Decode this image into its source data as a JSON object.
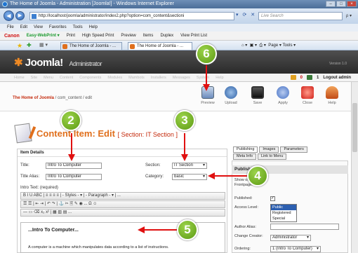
{
  "browser": {
    "window_title": "The Home of Joomla - Administration [Joomla!] - Windows Internet Explorer",
    "address": "http://localhost/joomla/administrator/index2.php?option=com_content&sectioni",
    "search_placeholder": "Live Search",
    "menu": [
      "File",
      "Edit",
      "View",
      "Favorites",
      "Tools",
      "Help"
    ],
    "canon_brand": "Canon",
    "canon_product": "Easy-WebPrint ▾",
    "canon_items": [
      "Print",
      "High Speed Print",
      "Preview",
      "Items",
      "Duplex",
      "View Print List"
    ],
    "tabs": [
      "The Home of Joomla - ...",
      "The Home of Joomla - ..."
    ],
    "tools_text": "Page ▾  Tools ▾"
  },
  "joomla": {
    "logo": "Joomla!",
    "logo_suffix": "Administrator",
    "version": "Version 1.0",
    "nav": [
      "Home",
      "Site",
      "Menu",
      "Content",
      "Components",
      "Modules",
      "Mambots",
      "Installers",
      "Messages",
      "System",
      "Help"
    ],
    "logout": "Logout admin",
    "status_count_a": "0",
    "status_count_b": "1",
    "breadcrumb_home": "The Home of Joomla",
    "breadcrumb_path": " / com_content / edit",
    "toolbar": {
      "preview": "Preview",
      "upload": "Upload",
      "save": "Save",
      "apply": "Apply",
      "close": "Close",
      "help": "Help"
    },
    "content_title": "Content Item: Edit",
    "content_section": "[ Section: IT Section ]",
    "item_details": "Item Details",
    "form": {
      "title_label": "Title:",
      "title_value": "Intro To Computer",
      "alias_label": "Title Alias:",
      "alias_value": "Intro To Computer",
      "section_label": "Section:",
      "section_value": "IT Section",
      "category_label": "Category:",
      "category_value": "basic",
      "intro_label": "Intro Text: (required)"
    },
    "editor": {
      "row1": "B  I  U  ABC  |  ≡  ≡  ≡  ≡  |  - Styles -  ▾  |  - Paragraph -  ▾  |  ...",
      "row2": "☰  ☰  |  ⇤  ⇥  |  ↶  ↷  |  ⚓  ✂  🖹  ✎  ◉  ...  Ω  ☺",
      "row3": "—  ▭  ⌫  x₂  x²  |  ▦  ▥  ▤  ...",
      "heading": "...Intro To Computer...",
      "body": "A computer is a machine which manipulates data according to a list of instructions."
    },
    "right_tabs": [
      "Publishing",
      "Images",
      "Parameters"
    ],
    "right_tabs2": [
      "Meta Info",
      "Link to Menu"
    ],
    "publishing": {
      "head": "Publishing",
      "frontpage_label": "Show on Frontpage:",
      "published_label": "Published:",
      "published_check": "✓",
      "access_label": "Access Level:",
      "access_options": [
        "Public",
        "Registered",
        "Special"
      ],
      "author_alias_label": "Author Alias:",
      "change_creator_label": "Change Creator:",
      "change_creator_value": "Administrator",
      "ordering_label": "Ordering:",
      "ordering_value": "1 (Intro To Computer)"
    }
  },
  "callouts": [
    "2",
    "3",
    "4",
    "5",
    "6"
  ]
}
